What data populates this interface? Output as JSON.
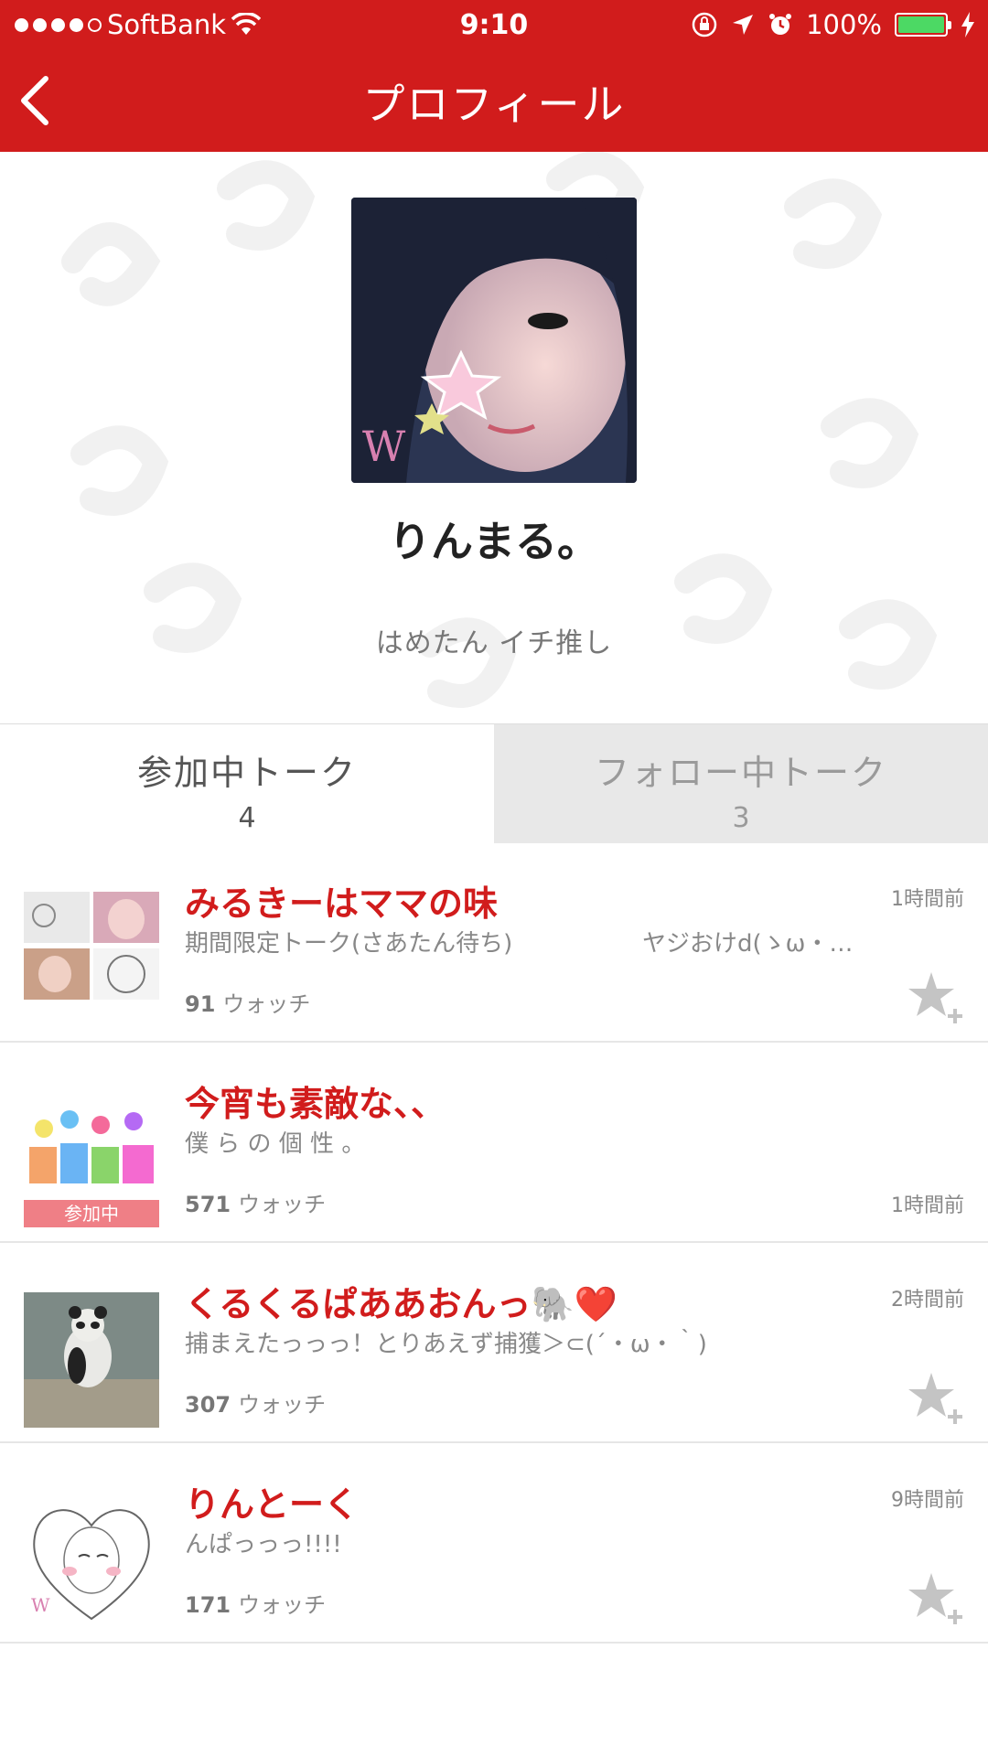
{
  "colors": {
    "accent": "#d11c1c",
    "title": "#d11c1c",
    "battery": "#4cd964"
  },
  "status_bar": {
    "carrier": "SoftBank",
    "time": "9:10",
    "battery": "100%"
  },
  "nav": {
    "title": "プロフィール",
    "back_icon": "chevron-left-icon"
  },
  "profile": {
    "name": "りんまる。",
    "bio": "はめたん イチ推し"
  },
  "tabs": [
    {
      "label": "参加中トーク",
      "count": "4"
    },
    {
      "label": "フォロー中トーク",
      "count": "3"
    }
  ],
  "talks": [
    {
      "title": "みるきーはママの味",
      "subtitle": "期間限定トーク(さあたん待ち)",
      "subtitle_extra": "ヤジおけd(ゝω・…",
      "watch_count": "91",
      "watch_label": "ウォッチ",
      "time": "1時間前",
      "favorite": "star-add-icon"
    },
    {
      "title": "今宵も素敵な、、",
      "subtitle": "僕 ら の 個 性 。",
      "watch_count": "571",
      "watch_label": "ウォッチ",
      "time": "1時間前",
      "badge": "参加中"
    },
    {
      "title": "くるくるぱああおんっ🐘❤️",
      "subtitle": "捕まえたっっっ！とりあえず捕獲＞⊂(´・ω・｀)",
      "watch_count": "307",
      "watch_label": "ウォッチ",
      "time": "2時間前",
      "favorite": "star-add-icon"
    },
    {
      "title": "りんとーく",
      "subtitle": "んぱっっっ!!!!",
      "watch_count": "171",
      "watch_label": "ウォッチ",
      "time": "9時間前",
      "favorite": "star-add-icon"
    }
  ]
}
